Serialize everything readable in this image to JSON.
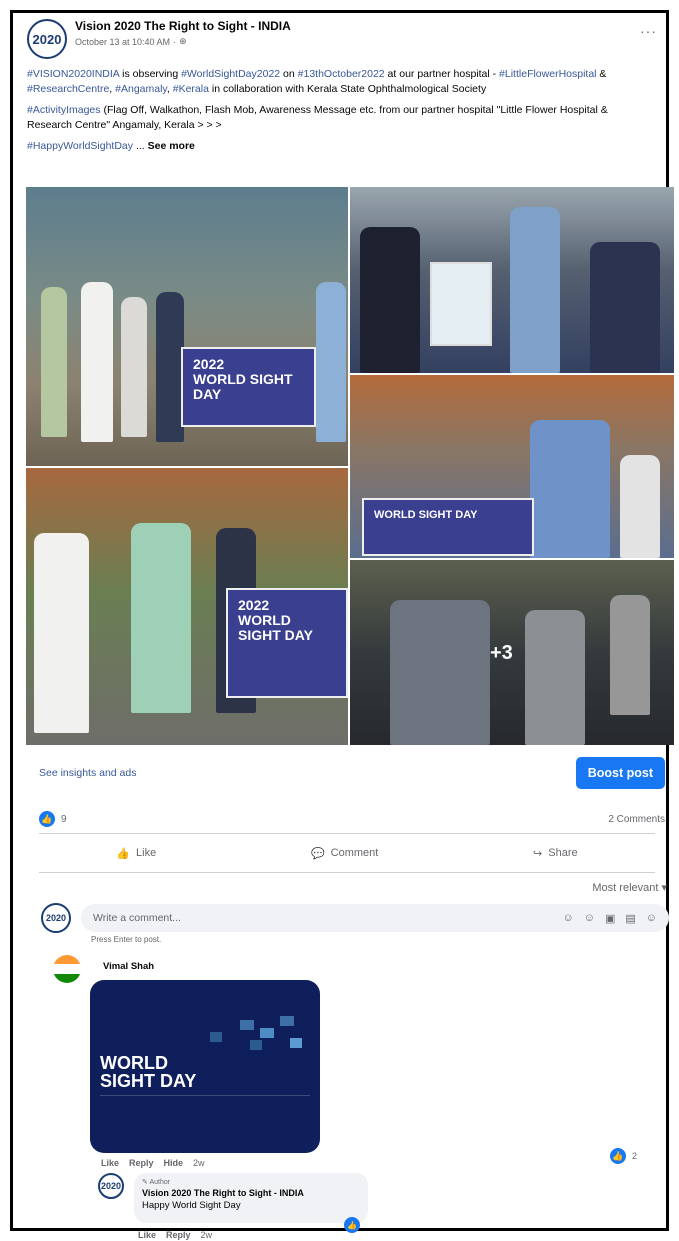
{
  "post": {
    "page_name": "Vision 2020 The Right to Sight - INDIA",
    "logo_text": "2020",
    "timestamp": "October 13 at 10:40 AM",
    "more_icon": "more-icon",
    "text": {
      "line1_tag1": "#VISION2020INDIA",
      "line1_a": " is observing ",
      "line1_tag2": "#WorldSightDay2022",
      "line1_b": " on ",
      "line1_tag3": "#13thOctober2022",
      "line1_c": " at our partner hospital - ",
      "line1_tag4": "#LittleFlowerHospital",
      "line1_d": " & ",
      "line1_tag5": "#ResearchCentre",
      "line1_e": ", ",
      "line1_tag6": "#Angamaly",
      "line1_f": ", ",
      "line1_tag7": "#Kerala",
      "line1_g": " in collaboration with Kerala State Ophthalmological Society",
      "line2_tag": "#ActivityImages",
      "line2_text": " (Flag Off, Walkathon, Flash Mob, Awareness Message etc. from our partner hospital \"Little Flower Hospital & Research Centre\" Angamaly, Kerala > > >",
      "line3_tag": "#HappyWorldSightDay",
      "line3_dots": " ... ",
      "see_more": "See more"
    },
    "banner_text": "WORLD SIGHT DAY",
    "banner_year": "2022",
    "extra_photos": "+3"
  },
  "bar": {
    "insights": "See insights and ads",
    "boost": "Boost post"
  },
  "stats": {
    "likes": "9",
    "comments": "2 Comments"
  },
  "actions": {
    "like": "Like",
    "comment": "Comment",
    "share": "Share"
  },
  "sort": "Most relevant ▾",
  "composer": {
    "placeholder": "Write a comment...",
    "hint": "Press Enter to post."
  },
  "comment1": {
    "name": "Vimal Shah",
    "ad_title_1": "WORLD",
    "ad_title_2": "SIGHT DAY",
    "like": "Like",
    "reply": "Reply",
    "hide": "Hide",
    "time": "2w",
    "reactions": "2"
  },
  "reply1": {
    "author_badge": "Author",
    "name": "Vision 2020 The Right to Sight - INDIA",
    "text": "Happy World Sight Day",
    "like": "Like",
    "reply": "Reply",
    "time": "2w"
  },
  "colors": {
    "accent": "#1877f2",
    "link": "#385898",
    "ad_bg": "#0e1f5c"
  }
}
